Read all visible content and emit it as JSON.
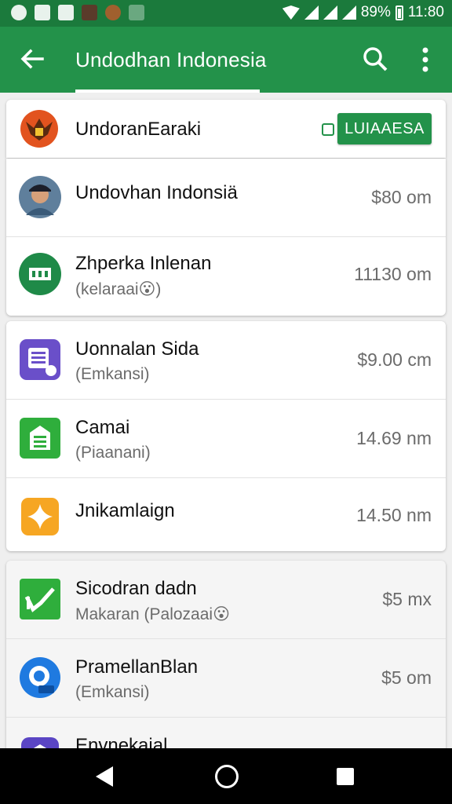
{
  "status_bar": {
    "battery": "89%",
    "time": "11:80",
    "icons": [
      "whatsapp-icon",
      "image-icon",
      "gallery-icon",
      "photo-icon",
      "avatar-icon",
      "notification-icon",
      "wifi-icon",
      "signal-icon",
      "signal-icon",
      "battery-icon"
    ]
  },
  "toolbar": {
    "title": "Undodhan Indonesia",
    "back_icon": "arrow-left-icon",
    "search_icon": "search-icon",
    "more_icon": "more-vert-icon",
    "color": "#23924a"
  },
  "header": {
    "title": "UndoranEaraki",
    "button_label": "LUIAAESA",
    "emblem_icon": "garuda-emblem-icon"
  },
  "groups": [
    {
      "items": [
        {
          "icon": "avatar-photo",
          "title": "Undovhan Indonsiä",
          "subtitle": "",
          "amount": "$80 om"
        },
        {
          "icon": "green-card-icon",
          "title": "Zhperka Inlenan",
          "subtitle": "(kelaraai😮)",
          "amount": "11130 om"
        }
      ]
    },
    {
      "items": [
        {
          "icon": "purple-list-icon",
          "title": "Uonnalan Sida",
          "subtitle": "(Emkansi)",
          "amount": "$9.00 cm"
        },
        {
          "icon": "green-doc-icon",
          "title": "Camai",
          "subtitle": "(Piaanani)",
          "amount": "14.69 nm"
        },
        {
          "icon": "orange-star-icon",
          "title": "Jnikamlaign",
          "subtitle": "",
          "amount": "14.50 nm"
        }
      ]
    },
    {
      "items": [
        {
          "icon": "green-check-icon",
          "title": "Sicodran dadn",
          "subtitle": "Makaran (Palozaai😮",
          "amount": "$5 mx"
        },
        {
          "icon": "blue-search-icon",
          "title": "PramellanBlan",
          "subtitle": "(Emkansi)",
          "amount": "$5 om"
        },
        {
          "icon": "purple-shield-icon",
          "title": "Envnekaial",
          "subtitle": "",
          "amount": ""
        }
      ]
    }
  ]
}
